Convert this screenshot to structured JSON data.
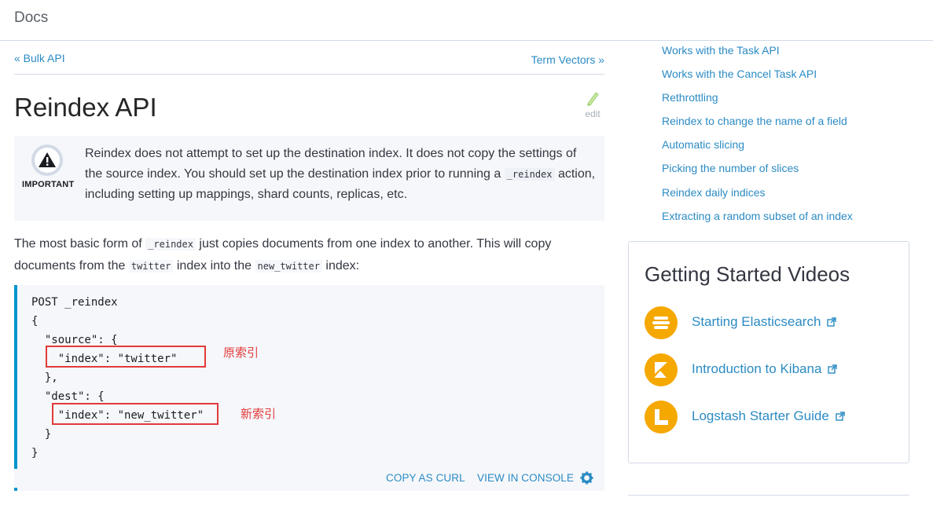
{
  "header": {
    "title": "Docs"
  },
  "nav": {
    "prev": "«  Bulk API",
    "next": "Term Vectors  »"
  },
  "page": {
    "title": "Reindex API",
    "edit_label": "edit"
  },
  "important": {
    "label": "IMPORTANT",
    "text_1": "Reindex does not attempt to set up the destination index. It does not copy the settings of the source index. You should set up the destination index prior to running a ",
    "code": "_reindex",
    "text_2": " action, including setting up mappings, shard counts, replicas, etc."
  },
  "intro": {
    "t1": "The most basic form of ",
    "c1": "_reindex",
    "t2": " just copies documents from one index to another. This will copy documents from the ",
    "c2": "twitter",
    "t3": " index into the ",
    "c3": "new_twitter",
    "t4": " index:"
  },
  "code": {
    "lines": [
      "POST _reindex",
      "{",
      "  \"source\": {",
      "    \"index\": \"twitter\"",
      "  },",
      "  \"dest\": {",
      "    \"index\": \"new_twitter\"",
      "  }",
      "}"
    ],
    "annotation_source": "原索引",
    "annotation_dest": "新索引",
    "copy_as_curl": "COPY AS CURL",
    "view_in_console": "VIEW IN CONSOLE"
  },
  "toc": {
    "items": [
      "Works with the Task API",
      "Works with the Cancel Task API",
      "Rethrottling",
      "Reindex to change the name of a field",
      "Automatic slicing",
      "Picking the number of slices",
      "Reindex daily indices",
      "Extracting a random subset of an index"
    ]
  },
  "videos": {
    "title": "Getting Started Videos",
    "items": [
      {
        "label": "Starting Elasticsearch",
        "icon": "elasticsearch-logo-icon"
      },
      {
        "label": "Introduction to Kibana",
        "icon": "kibana-logo-icon"
      },
      {
        "label": "Logstash Starter Guide",
        "icon": "logstash-logo-icon"
      }
    ]
  },
  "colors": {
    "link": "#2b8bc4",
    "accent_border": "#0095cc",
    "highlight": "#e33a3a",
    "badge": "#f5a800"
  }
}
